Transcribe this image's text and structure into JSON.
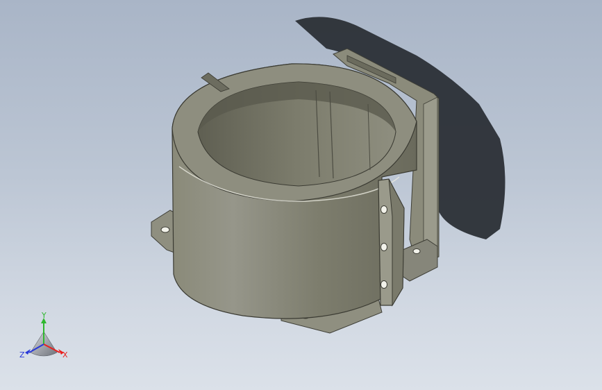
{
  "viewport": {
    "model": "cylindrical-housing-with-mounting-flanges",
    "background_top": "#a9b5c7",
    "background_bottom": "#dbe1e9",
    "part_color": "#7f7f6f",
    "shadow_color": "#2b2f36"
  },
  "triad": {
    "x_label": "X",
    "y_label": "Y",
    "z_label": "Z",
    "x_color": "#e8201e",
    "y_color": "#2fb82f",
    "z_color": "#2838d8"
  }
}
